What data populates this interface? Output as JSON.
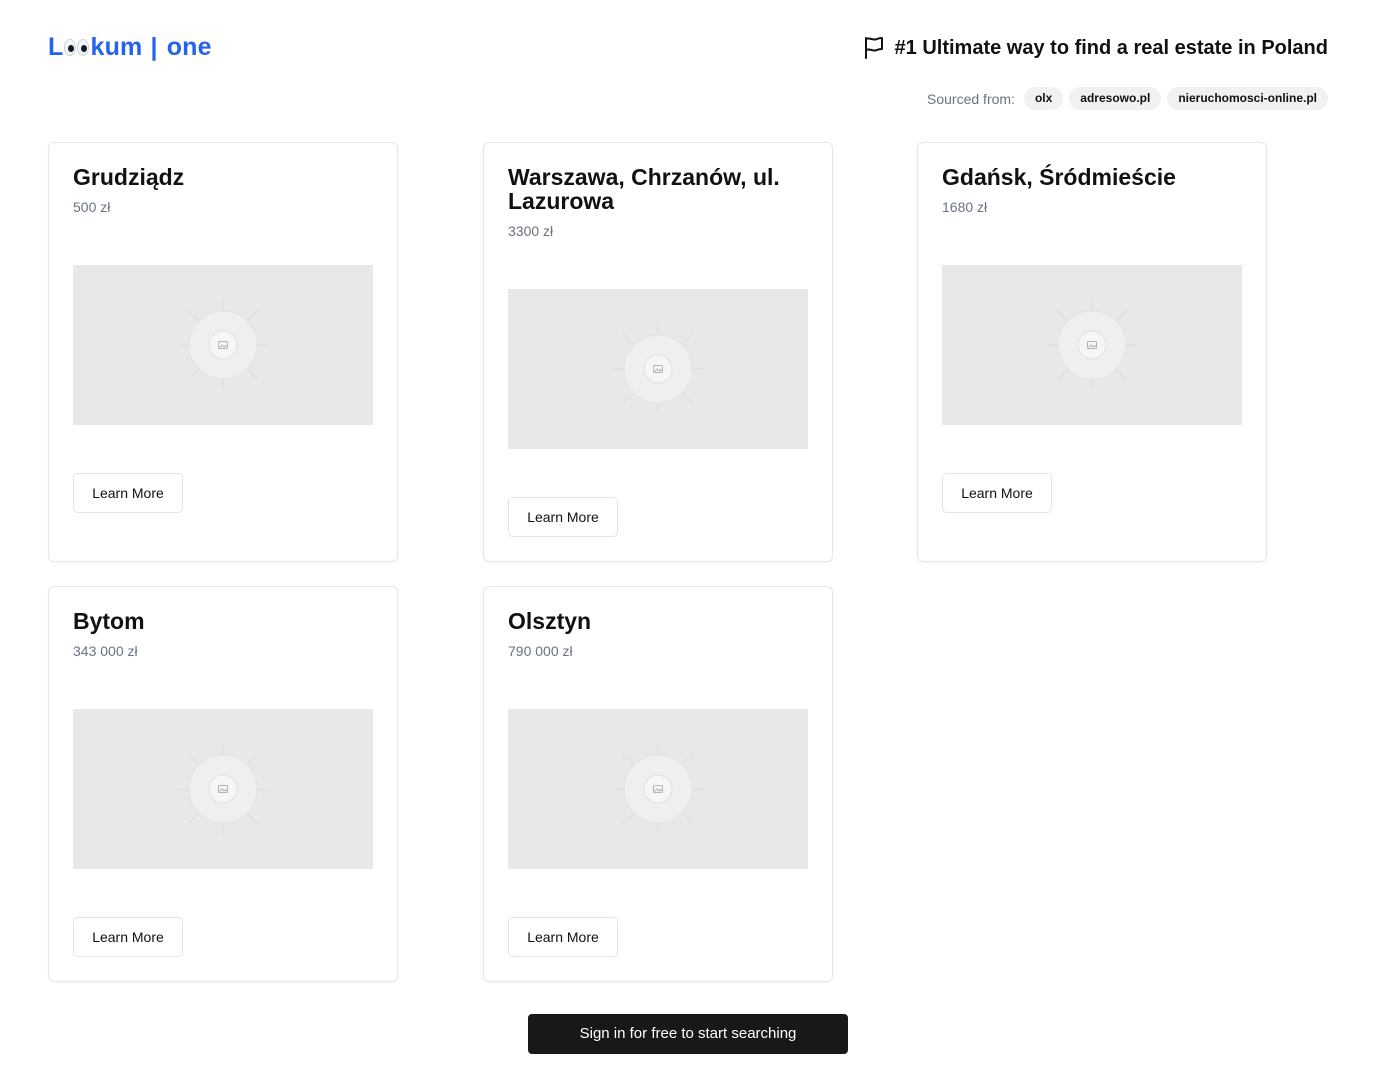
{
  "header": {
    "logo": {
      "left": "L",
      "right": "kum",
      "separator": "|",
      "suffix": "one"
    },
    "tagline": "#1 Ultimate way to find a real estate in Poland",
    "tagline_icon": "flag-icon"
  },
  "sources": {
    "label": "Sourced from:",
    "items": [
      "olx",
      "adresowo.pl",
      "nieruchomosci-online.pl"
    ]
  },
  "listings": [
    {
      "title": "Grudziądz",
      "price": "500 zł",
      "button": "Learn More",
      "image_icon": "image-placeholder-icon"
    },
    {
      "title": "Warszawa, Chrzanów, ul. Lazurowa",
      "price": "3300 zł",
      "button": "Learn More",
      "image_icon": "image-placeholder-icon"
    },
    {
      "title": "Gdańsk, Śródmieście",
      "price": "1680 zł",
      "button": "Learn More",
      "image_icon": "image-placeholder-icon"
    },
    {
      "title": "Bytom",
      "price": "343 000 zł",
      "button": "Learn More",
      "image_icon": "image-placeholder-icon"
    },
    {
      "title": "Olsztyn",
      "price": "790 000 zł",
      "button": "Learn More",
      "image_icon": "image-placeholder-icon"
    }
  ],
  "cta": {
    "label": "Sign in for free to start searching"
  },
  "colors": {
    "brand": "#2563eb",
    "cta_bg": "#18181b",
    "placeholder_bg": "#e8e8e8"
  }
}
